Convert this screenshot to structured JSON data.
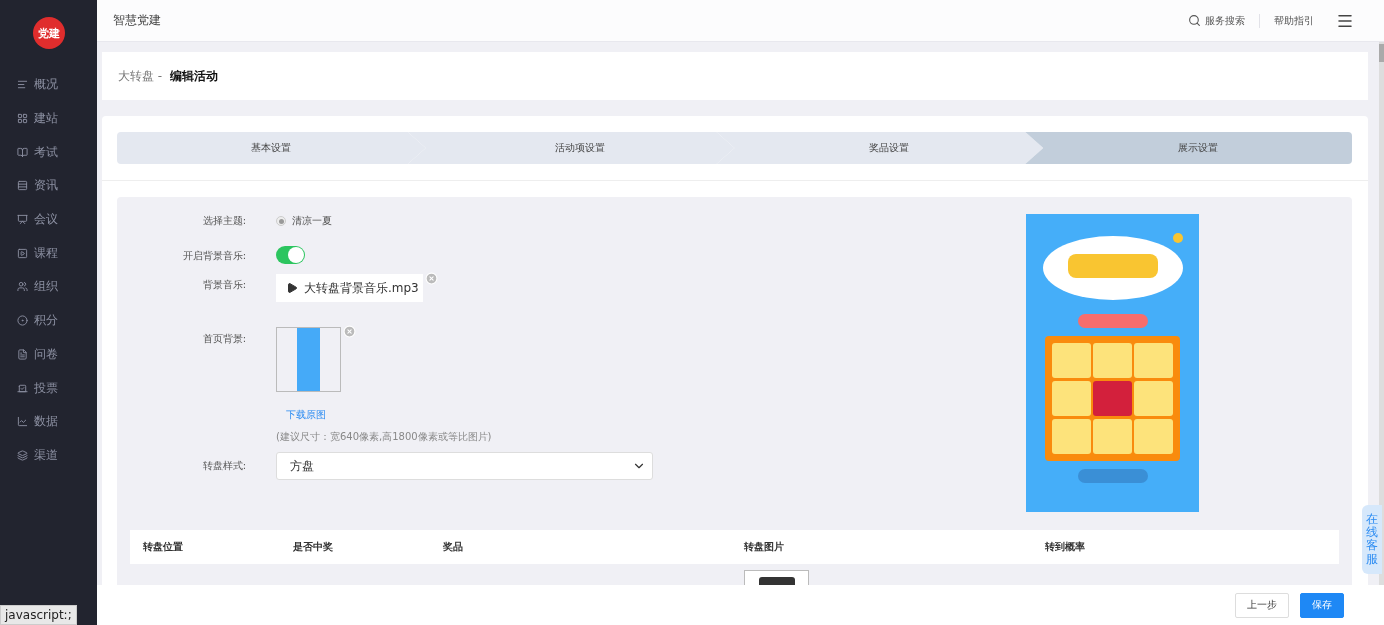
{
  "sidebar": {
    "logo_text": "党建",
    "items": [
      {
        "label": "概况",
        "selected": false
      },
      {
        "label": "建站",
        "selected": false
      },
      {
        "label": "考试",
        "selected": false
      },
      {
        "label": "资讯",
        "selected": false
      },
      {
        "label": "会议",
        "selected": false
      },
      {
        "label": "课程",
        "selected": false
      },
      {
        "label": "组织",
        "selected": false
      },
      {
        "label": "积分",
        "selected": false
      },
      {
        "label": "问卷",
        "selected": false
      },
      {
        "label": "投票",
        "selected": false
      },
      {
        "label": "数据",
        "selected": false
      },
      {
        "label": "渠道",
        "selected": false
      }
    ]
  },
  "header": {
    "title": "智慧党建",
    "search": "服务搜索",
    "help": "帮助指引"
  },
  "breadcrumb": {
    "parent": "大转盘 -",
    "current": "编辑活动"
  },
  "steps": [
    {
      "label": "基本设置",
      "selected": false
    },
    {
      "label": "活动项设置",
      "selected": false
    },
    {
      "label": "奖品设置",
      "selected": false
    },
    {
      "label": "展示设置",
      "selected": true
    }
  ],
  "form": {
    "theme": {
      "label": "选择主题:",
      "option": "清凉一夏",
      "checked": true,
      "disabled": true
    },
    "music_toggle": {
      "label": "开启背景音乐:",
      "on": true
    },
    "music": {
      "label": "背景音乐:",
      "file": "大转盘背景音乐.mp3"
    },
    "background": {
      "label": "首页背景:",
      "link": "下载原图",
      "hint": "(建议尺寸：宽640像素,高1800像素或等比图片)"
    },
    "wheel_style": {
      "label": "转盘样式:",
      "value": "方盘"
    }
  },
  "table": {
    "columns": [
      "转盘位置",
      "是否中奖",
      "奖品",
      "转盘图片",
      "转到概率"
    ]
  },
  "footer": {
    "buttons": [
      {
        "label": "上一步",
        "kind": "secondary"
      },
      {
        "label": "保存",
        "kind": "primary"
      }
    ]
  },
  "service_tab": "在线客服",
  "status_bar": "javascript:;"
}
